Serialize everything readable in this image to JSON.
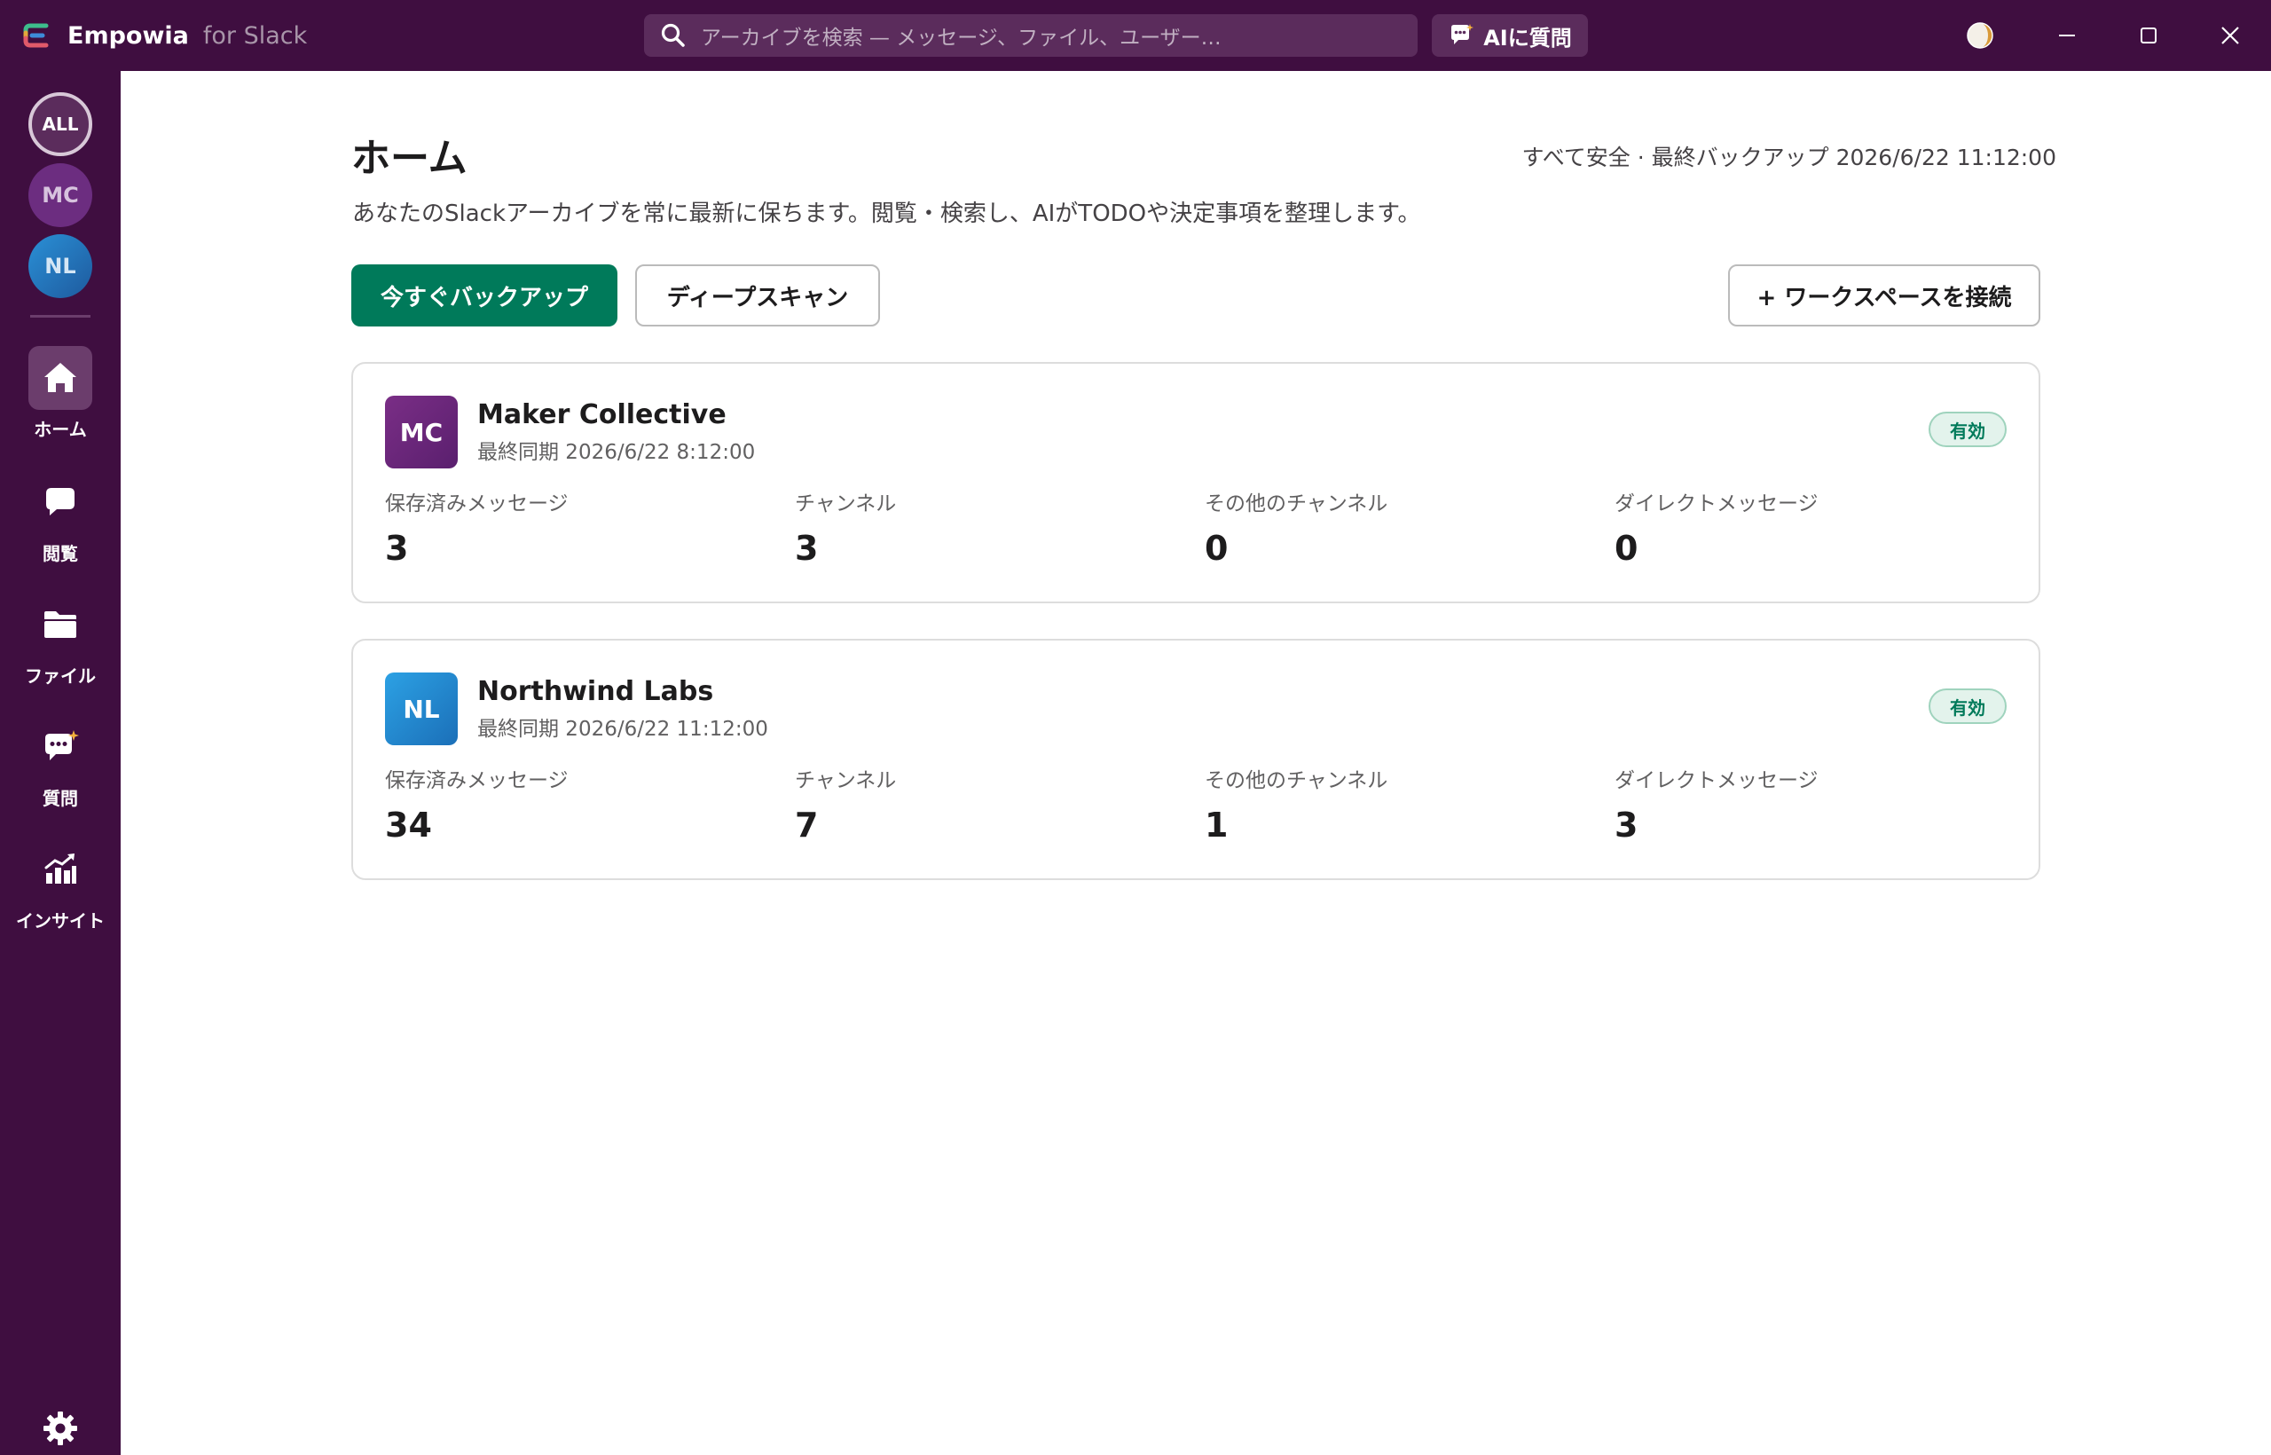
{
  "app": {
    "name": "Empowia",
    "name_suffix": "for Slack",
    "search_placeholder": "アーカイブを検索 — メッセージ、ファイル、ユーザー…",
    "ask_ai_label": "AIに質問"
  },
  "sidebar": {
    "workspaces": [
      {
        "label": "ALL"
      },
      {
        "label": "MC"
      },
      {
        "label": "NL"
      }
    ],
    "nav": [
      {
        "label": "ホーム",
        "icon": "home-icon",
        "active": true
      },
      {
        "label": "閲覧",
        "icon": "chat-bubble-icon",
        "active": false
      },
      {
        "label": "ファイル",
        "icon": "folder-icon",
        "active": false
      },
      {
        "label": "質問",
        "icon": "ai-chat-icon",
        "active": false
      },
      {
        "label": "インサイト",
        "icon": "chart-icon",
        "active": false
      }
    ],
    "settings_label": "設定"
  },
  "main": {
    "title": "ホーム",
    "backup_status": "すべて安全 · 最終バックアップ 2026/6/22 11:12:00",
    "subtitle": "あなたのSlackアーカイブを常に最新に保ちます。閲覧・検索し、AIがTODOや決定事項を整理します。",
    "buttons": {
      "backup_now": "今すぐバックアップ",
      "deep_scan": "ディープスキャン",
      "connect_workspace": "+ ワークスペースを接続"
    },
    "workspaces": [
      {
        "initials": "MC",
        "name": "Maker Collective",
        "last_sync": "最終同期 2026/6/22 8:12:00",
        "status": "有効",
        "stats": [
          {
            "label": "保存済みメッセージ",
            "value": "3"
          },
          {
            "label": "チャンネル",
            "value": "3"
          },
          {
            "label": "その他のチャンネル",
            "value": "0"
          },
          {
            "label": "ダイレクトメッセージ",
            "value": "0"
          }
        ]
      },
      {
        "initials": "NL",
        "name": "Northwind Labs",
        "last_sync": "最終同期 2026/6/22 11:12:00",
        "status": "有効",
        "stats": [
          {
            "label": "保存済みメッセージ",
            "value": "34"
          },
          {
            "label": "チャンネル",
            "value": "7"
          },
          {
            "label": "その他のチャンネル",
            "value": "1"
          },
          {
            "label": "ダイレクトメッセージ",
            "value": "3"
          }
        ]
      }
    ]
  },
  "colors": {
    "sidebar_bg": "#3f0e40",
    "primary_button": "#007a5a",
    "badge_text": "#007a5a"
  }
}
